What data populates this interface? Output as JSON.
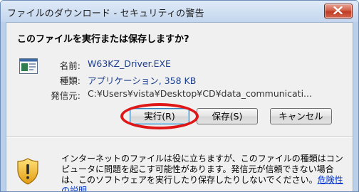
{
  "window": {
    "title": "ファイルのダウンロード - セキュリティの警告"
  },
  "dialog": {
    "question": "このファイルを実行または保存しますか?",
    "file_info": {
      "name_label": "名前:",
      "name_value": "W63KZ_Driver.EXE",
      "type_label": "種類:",
      "type_value": "アプリケーション, 358 KB",
      "from_label": "発信元:",
      "from_value": "C:¥Users¥vista¥Desktop¥CD¥data_communicati..."
    },
    "buttons": {
      "run": "実行(R)",
      "save": "保存(S)",
      "cancel": "キャンセル"
    },
    "warning": {
      "text": "インターネットのファイルは役に立ちますが、このファイルの種類はコンピュータに問題を起こす可能性があります。発信元が信頼できない場合は、このソフトウェアを実行したり保存したりしないでください。",
      "link": "危険性の説明"
    }
  },
  "colors": {
    "highlight_ellipse": "#e01717",
    "title_bar": "#c3d6ee",
    "link": "#0033cc"
  },
  "icons": [
    "close-icon",
    "application-file-icon",
    "security-shield-icon"
  ]
}
